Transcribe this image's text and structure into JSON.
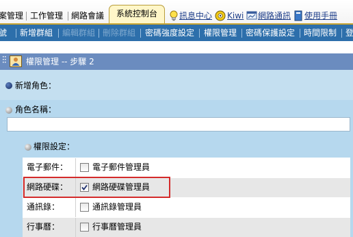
{
  "top_tabs": {
    "case_management": "案管理",
    "work_management": "工作管理",
    "online_meeting": "網路會議",
    "system_console": "系統控制台"
  },
  "utilities": {
    "message_center": "訊息中心",
    "kiwi": "Kiwi",
    "network_comm": "網路通訊",
    "user_manual": "使用手冊"
  },
  "submenu": {
    "items": [
      {
        "label": "號"
      },
      {
        "label": "新增群組"
      },
      {
        "label": "編輯群組"
      },
      {
        "label": "刪除群組"
      },
      {
        "label": "密碼強度設定"
      },
      {
        "label": "權限管理"
      },
      {
        "label": "密碼保護設定"
      },
      {
        "label": "時間限制"
      },
      {
        "label": "登"
      }
    ]
  },
  "page": {
    "title": "權限管理 -- 步驟 2"
  },
  "form": {
    "new_role_label": "新增角色：",
    "role_name_label": "角色名稱：",
    "role_name_value": "",
    "permission_settings_label": "權限設定："
  },
  "permissions": {
    "rows": [
      {
        "label": "電子郵件：",
        "option": "電子郵件管理員",
        "checked": false
      },
      {
        "label": "網路硬碟：",
        "option": "網路硬碟管理員",
        "checked": true
      },
      {
        "label": "通訊錄：",
        "option": "通訊錄管理員",
        "checked": false
      },
      {
        "label": "行事曆：",
        "option": "行事曆管理員",
        "checked": false
      }
    ]
  },
  "colors": {
    "submenu_bg": "#2d6fab",
    "titlebar_bg": "#6b8cbf",
    "content_bg": "#b6d8ee",
    "highlight": "#d42a2a",
    "active_tab_bg": "#fff6c8"
  }
}
